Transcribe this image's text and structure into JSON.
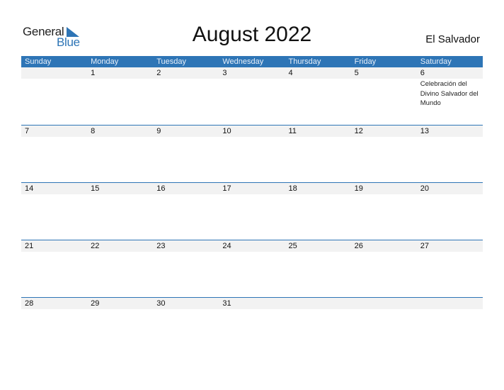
{
  "logo": {
    "line1": "General",
    "line2": "Blue"
  },
  "title": "August 2022",
  "country": "El Salvador",
  "colors": {
    "accent": "#2e75b6",
    "strip": "#f2f2f2"
  },
  "weekdays": [
    "Sunday",
    "Monday",
    "Tuesday",
    "Wednesday",
    "Thursday",
    "Friday",
    "Saturday"
  ],
  "weeks": [
    {
      "days": [
        "",
        "1",
        "2",
        "3",
        "4",
        "5",
        "6"
      ],
      "events": [
        "",
        "",
        "",
        "",
        "",
        "",
        "Celebración del Divino Salvador del Mundo"
      ]
    },
    {
      "days": [
        "7",
        "8",
        "9",
        "10",
        "11",
        "12",
        "13"
      ],
      "events": [
        "",
        "",
        "",
        "",
        "",
        "",
        ""
      ]
    },
    {
      "days": [
        "14",
        "15",
        "16",
        "17",
        "18",
        "19",
        "20"
      ],
      "events": [
        "",
        "",
        "",
        "",
        "",
        "",
        ""
      ]
    },
    {
      "days": [
        "21",
        "22",
        "23",
        "24",
        "25",
        "26",
        "27"
      ],
      "events": [
        "",
        "",
        "",
        "",
        "",
        "",
        ""
      ]
    },
    {
      "days": [
        "28",
        "29",
        "30",
        "31",
        "",
        "",
        ""
      ],
      "events": [
        "",
        "",
        "",
        "",
        "",
        "",
        ""
      ]
    }
  ]
}
